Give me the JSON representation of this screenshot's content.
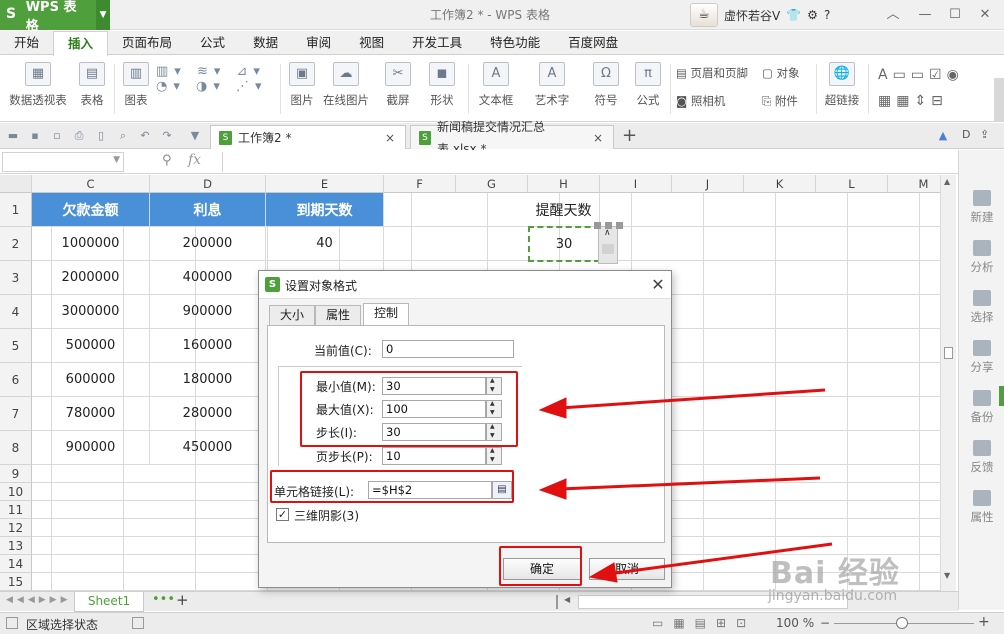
{
  "app": {
    "name": "WPS 表格",
    "title": "工作簿2 * - WPS 表格",
    "user": "虚怀若谷V"
  },
  "menu": [
    "开始",
    "插入",
    "页面布局",
    "公式",
    "数据",
    "审阅",
    "视图",
    "开发工具",
    "特色功能",
    "百度网盘"
  ],
  "ribbon": {
    "pivot": "数据透视表",
    "table": "表格",
    "chart": "图表",
    "picture": "图片",
    "online_picture": "在线图片",
    "screenshot": "截屏",
    "shape": "形状",
    "textbox": "文本框",
    "wordart": "艺术字",
    "symbol": "符号",
    "formula": "公式",
    "header_footer": "页眉和页脚",
    "object": "对象",
    "camera": "照相机",
    "attachment": "附件",
    "hyperlink": "超链接"
  },
  "tabs": [
    {
      "label": "工作簿2 *"
    },
    {
      "label": "新闻稿提交情况汇总表.xlsx *"
    }
  ],
  "columns": [
    "C",
    "D",
    "E",
    "F",
    "G",
    "H",
    "I",
    "J",
    "K",
    "L",
    "M"
  ],
  "rows": [
    "1",
    "2",
    "3",
    "4",
    "5",
    "6",
    "7",
    "8",
    "9",
    "10",
    "11",
    "12",
    "13",
    "14",
    "15"
  ],
  "table": {
    "headers": [
      "欠款金额",
      "利息",
      "到期天数"
    ],
    "data": [
      [
        "1000000",
        "200000",
        "40"
      ],
      [
        "2000000",
        "400000",
        ""
      ],
      [
        "3000000",
        "900000",
        ""
      ],
      [
        "500000",
        "160000",
        ""
      ],
      [
        "600000",
        "180000",
        ""
      ],
      [
        "780000",
        "280000",
        ""
      ],
      [
        "900000",
        "450000",
        ""
      ]
    ],
    "remind_label": "提醒天数",
    "remind_value": "30"
  },
  "sidebar": [
    "新建",
    "分析",
    "选择",
    "分享",
    "备份",
    "反馈",
    "属性"
  ],
  "sheet": {
    "name": "Sheet1"
  },
  "status": {
    "mode": "区域选择状态",
    "zoom": "100 %"
  },
  "dialog": {
    "title": "设置对象格式",
    "tabs": [
      "大小",
      "属性",
      "控制"
    ],
    "current_label": "当前值(C):",
    "current_value": "0",
    "min_label": "最小值(M):",
    "min_value": "30",
    "max_label": "最大值(X):",
    "max_value": "100",
    "step_label": "步长(I):",
    "step_value": "30",
    "page_label": "页步长(P):",
    "page_value": "10",
    "link_label": "单元格链接(L):",
    "link_value": "=$H$2",
    "shadow_label": "三维阴影(3)",
    "ok": "确定",
    "cancel": "取消"
  },
  "watermark": {
    "brand": "Bai 经验",
    "url": "jingyan.baidu.com"
  },
  "colors": {
    "accent": "#4fa03c",
    "header_blue": "#4a90d9",
    "annotation": "#e01010"
  }
}
